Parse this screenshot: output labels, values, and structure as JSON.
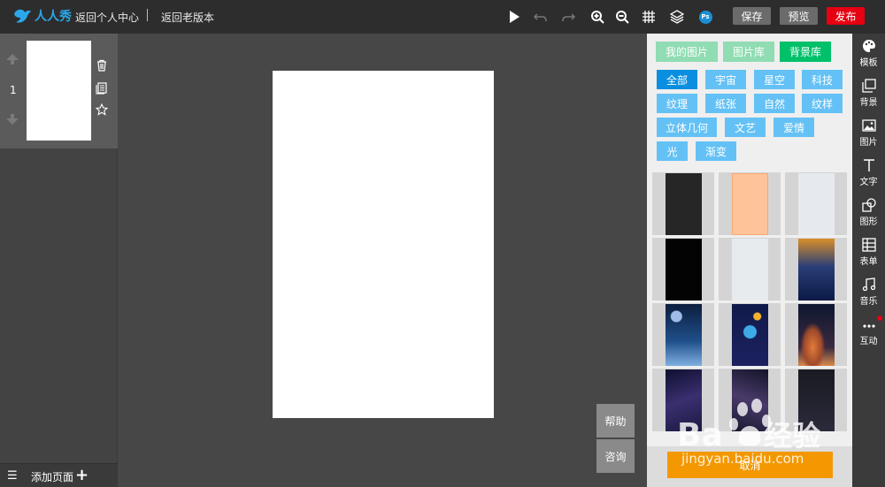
{
  "header": {
    "logo_text": "人人秀",
    "back_personal": "返回个人中心",
    "back_old": "返回老版本",
    "save": "保存",
    "preview": "预览",
    "publish": "发布",
    "ps_badge": "Ps",
    "colors": {
      "bar": "#2d2d2d",
      "btn_gray": "#6b6b6b",
      "publish_red": "#e60012",
      "logo_blue": "#2aa7ea"
    }
  },
  "pages": {
    "items": [
      {
        "number": "1"
      }
    ],
    "add_label": "添加页面"
  },
  "side_help": {
    "help": "帮助",
    "consult": "咨询"
  },
  "background_panel": {
    "tabs": [
      {
        "label": "我的图片",
        "active": false
      },
      {
        "label": "图片库",
        "active": false
      },
      {
        "label": "背景库",
        "active": true
      }
    ],
    "categories": [
      {
        "label": "全部",
        "active": true
      },
      {
        "label": "宇宙",
        "active": false
      },
      {
        "label": "星空",
        "active": false
      },
      {
        "label": "科技",
        "active": false
      },
      {
        "label": "纹理",
        "active": false
      },
      {
        "label": "纸张",
        "active": false
      },
      {
        "label": "自然",
        "active": false
      },
      {
        "label": "纹样",
        "active": false
      },
      {
        "label": "立体几何",
        "active": false
      },
      {
        "label": "文艺",
        "active": false
      },
      {
        "label": "爱情",
        "active": false
      },
      {
        "label": "光",
        "active": false
      },
      {
        "label": "渐变",
        "active": false
      }
    ],
    "thumbnails": [
      {
        "name": "dark-gray"
      },
      {
        "name": "peach"
      },
      {
        "name": "light-gray"
      },
      {
        "name": "black"
      },
      {
        "name": "pale-gray"
      },
      {
        "name": "lightning-sky"
      },
      {
        "name": "earth-space"
      },
      {
        "name": "planets"
      },
      {
        "name": "ringed-planet"
      },
      {
        "name": "milky-way"
      },
      {
        "name": "night-sky"
      },
      {
        "name": "dark-space"
      }
    ],
    "cancel": "取消",
    "colors": {
      "tab_inactive": "#90dcb3",
      "tab_active": "#00c06a",
      "tag": "#63c1f5",
      "tag_active": "#0a8fe0",
      "cancel": "#f39800"
    }
  },
  "rail": {
    "items": [
      {
        "label": "模板",
        "icon": "palette-icon"
      },
      {
        "label": "背景",
        "icon": "background-icon"
      },
      {
        "label": "图片",
        "icon": "image-icon"
      },
      {
        "label": "文字",
        "icon": "text-icon"
      },
      {
        "label": "图形",
        "icon": "shape-icon"
      },
      {
        "label": "表单",
        "icon": "form-icon"
      },
      {
        "label": "音乐",
        "icon": "music-icon"
      },
      {
        "label": "互动",
        "icon": "more-icon"
      }
    ]
  },
  "watermark": {
    "text": "jingyan.baidu.com",
    "brand": "Baidu经验"
  }
}
